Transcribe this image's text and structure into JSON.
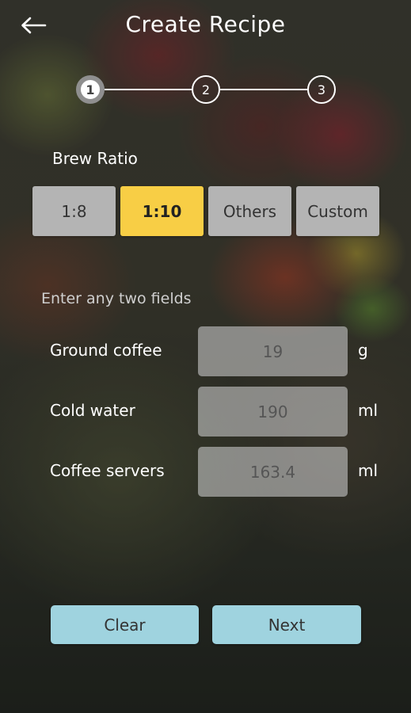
{
  "header": {
    "title": "Create Recipe",
    "back_icon": "arrow-left-icon"
  },
  "stepper": {
    "steps": [
      "1",
      "2",
      "3"
    ],
    "current_step": 1
  },
  "brew_ratio": {
    "label": "Brew Ratio",
    "options": [
      "1:8",
      "1:10",
      "Others",
      "Custom"
    ],
    "selected": "1:10"
  },
  "form": {
    "hint": "Enter any two fields",
    "fields": [
      {
        "label": "Ground coffee",
        "value": "19",
        "unit": "g"
      },
      {
        "label": "Cold water",
        "value": "190",
        "unit": "ml"
      },
      {
        "label": "Coffee servers",
        "value": "163.4",
        "unit": "ml"
      }
    ]
  },
  "actions": {
    "clear_label": "Clear",
    "next_label": "Next"
  },
  "colors": {
    "selected_option": "#f8ce45",
    "option": "#b4b4b4",
    "action_button": "#9fd3df"
  }
}
